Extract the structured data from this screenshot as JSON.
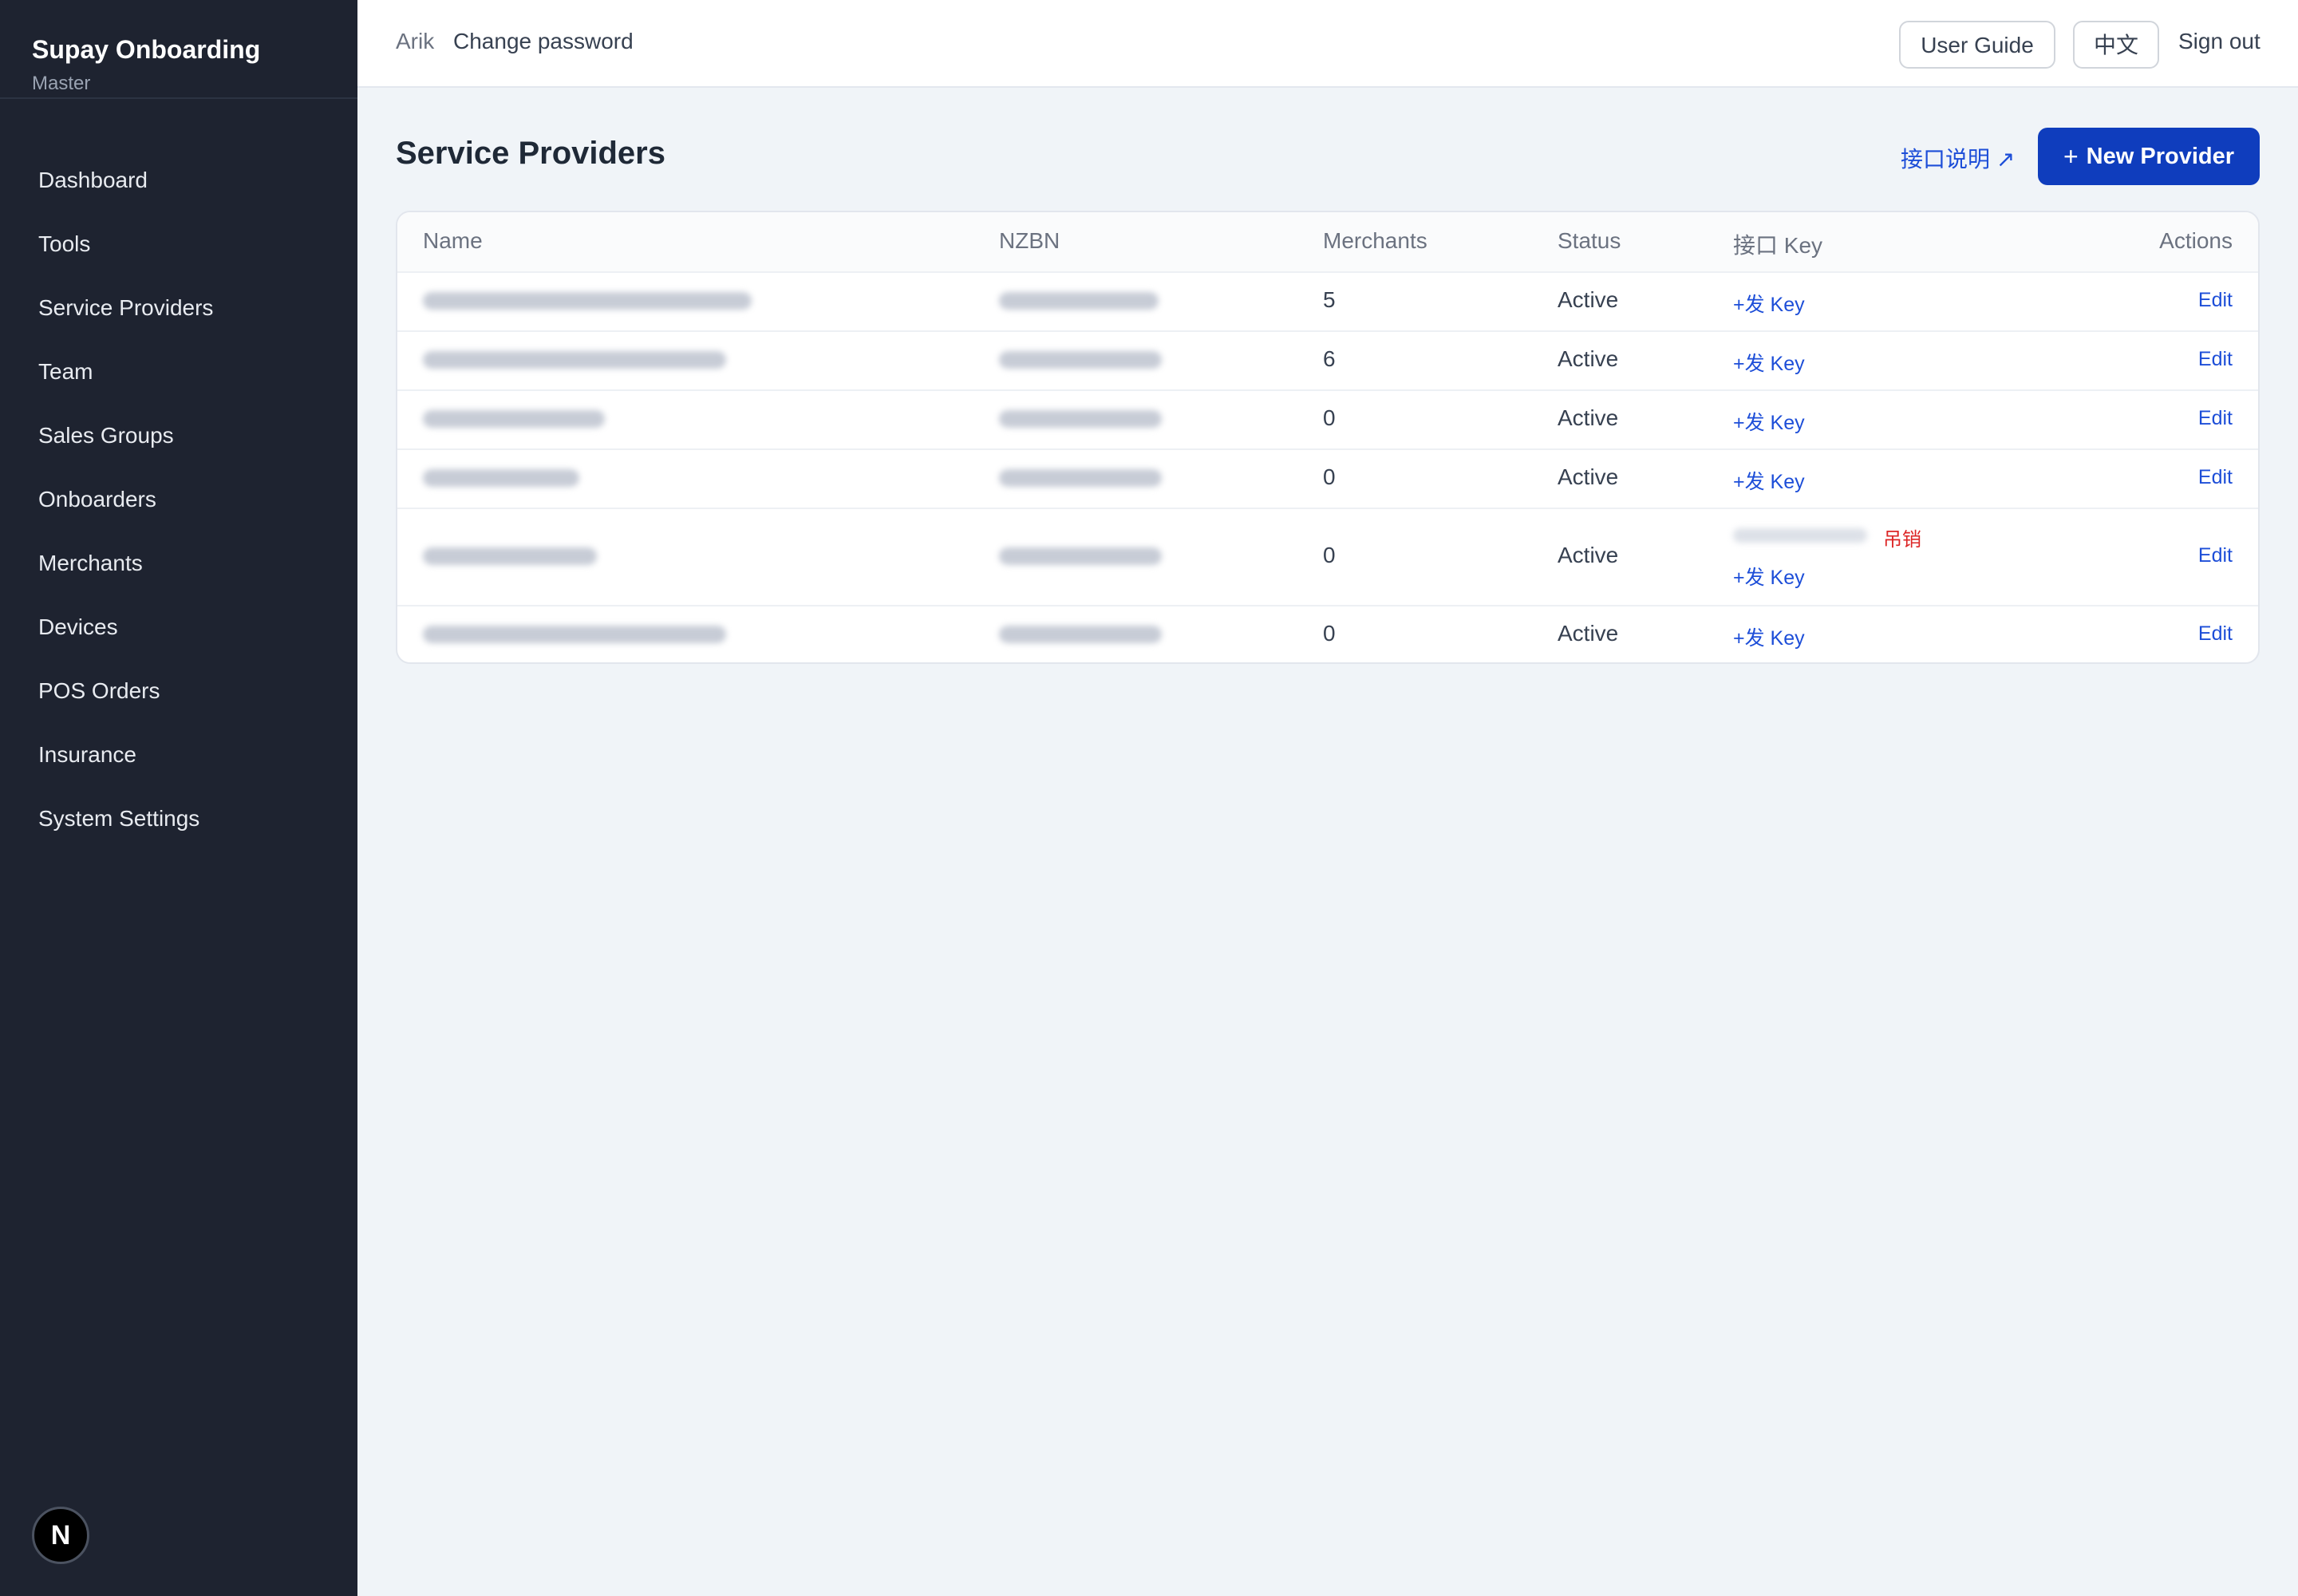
{
  "brand": {
    "title": "Supay Onboarding",
    "subtitle": "Master"
  },
  "sidebar": {
    "items": [
      {
        "label": "Dashboard"
      },
      {
        "label": "Tools"
      },
      {
        "label": "Service Providers"
      },
      {
        "label": "Team"
      },
      {
        "label": "Sales Groups"
      },
      {
        "label": "Onboarders"
      },
      {
        "label": "Merchants"
      },
      {
        "label": "Devices"
      },
      {
        "label": "POS Orders"
      },
      {
        "label": "Insurance"
      },
      {
        "label": "System Settings"
      }
    ],
    "logo_letter": "N"
  },
  "topbar": {
    "user": "Arik",
    "change_password": "Change password",
    "user_guide": "User Guide",
    "language": "中文",
    "sign_out": "Sign out"
  },
  "page": {
    "title": "Service Providers",
    "api_doc_link": "接口说明 ↗",
    "new_button": "New Provider",
    "new_button_icon": "+"
  },
  "table": {
    "headers": {
      "name": "Name",
      "nzbn": "NZBN",
      "merchants": "Merchants",
      "status": "Status",
      "api_key": "接口 Key",
      "actions": "Actions"
    },
    "rows": [
      {
        "merchants": "5",
        "status": "Active",
        "key_action": "+发 Key",
        "edit": "Edit"
      },
      {
        "merchants": "6",
        "status": "Active",
        "key_action": "+发 Key",
        "edit": "Edit"
      },
      {
        "merchants": "0",
        "status": "Active",
        "key_action": "+发 Key",
        "edit": "Edit"
      },
      {
        "merchants": "0",
        "status": "Active",
        "key_action": "+发 Key",
        "edit": "Edit"
      },
      {
        "merchants": "0",
        "status": "Active",
        "key_action": "+发 Key",
        "edit": "Edit",
        "revoke": "吊销"
      },
      {
        "merchants": "0",
        "status": "Active",
        "key_action": "+发 Key",
        "edit": "Edit"
      }
    ]
  },
  "colors": {
    "sidebar_bg": "#1e2330",
    "primary": "#0f3dbd",
    "link": "#1d4ed8",
    "danger": "#dc2626",
    "page_bg": "#f0f4f8"
  }
}
